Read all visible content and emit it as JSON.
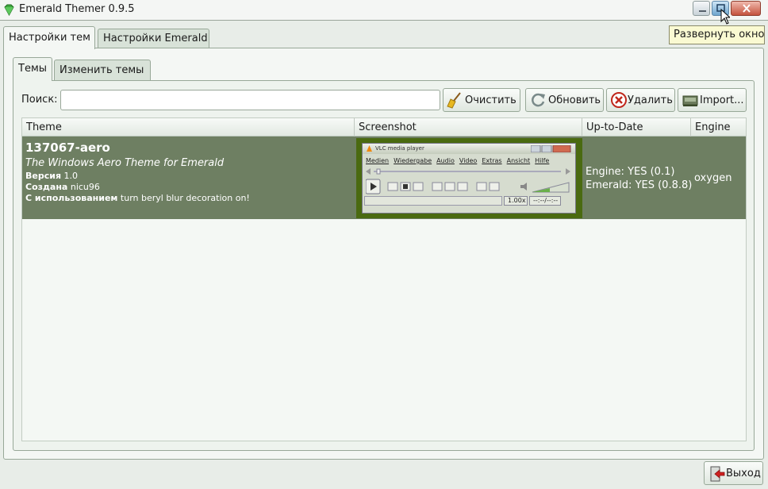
{
  "window": {
    "title": "Emerald Themer 0.9.5",
    "tooltip": "Развернуть окно"
  },
  "outer_tabs": [
    {
      "label": "Настройки тем",
      "active": true
    },
    {
      "label": "Настройки Emerald",
      "active": false
    }
  ],
  "inner_tabs": [
    {
      "label": "Темы",
      "active": true
    },
    {
      "label": "Изменить темы",
      "active": false
    }
  ],
  "search": {
    "label": "Поиск:",
    "value": ""
  },
  "toolbar": {
    "clear_label": "Очистить",
    "refresh_label": "Обновить",
    "delete_label": "Удалить",
    "import_label": "Import..."
  },
  "table": {
    "columns": [
      "Theme",
      "Screenshot",
      "Up-to-Date",
      "Engine"
    ],
    "rows": [
      {
        "name": "137067-aero",
        "description": "The Windows Aero Theme for Emerald",
        "version_label": "Версия",
        "version": "1.0",
        "author_label": "Создана",
        "author": "nicu96",
        "usage_label": "С использованием",
        "usage": "turn beryl blur decoration on!",
        "screenshot": {
          "title": "VLC media player",
          "menu": [
            "Medien",
            "Wiedergabe",
            "Audio",
            "Video",
            "Extras",
            "Ansicht",
            "Hilfe"
          ],
          "speed": "1.00x",
          "time": "--:--/--:--"
        },
        "uptodate_engine": "Engine: YES (0.1)",
        "uptodate_emerald": "Emerald: YES (0.8.8)",
        "engine": "oxygen"
      }
    ]
  },
  "exit_label": "Выход",
  "colors": {
    "selected_row": "#6e7f62",
    "window_bg": "#e8ede8",
    "tooltip_bg": "#fafad2"
  }
}
